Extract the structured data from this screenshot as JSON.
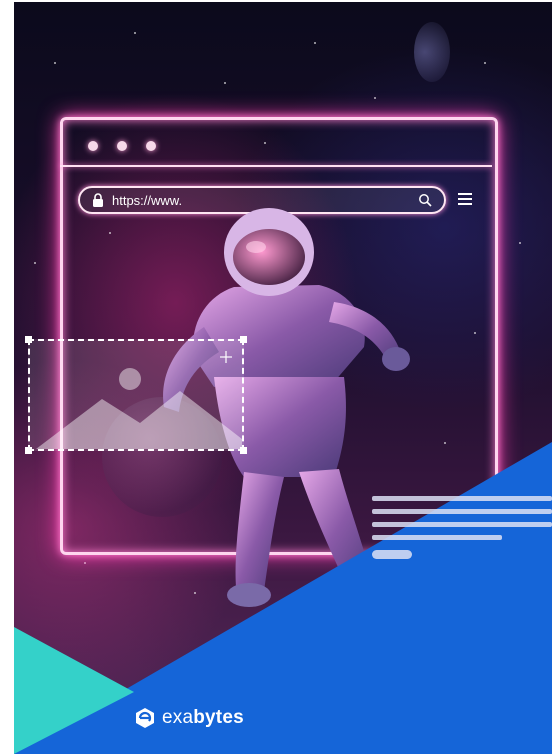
{
  "browser": {
    "url_text": "https://www.",
    "window_dots": 3
  },
  "brand": {
    "logo_regular": "exa",
    "logo_bold": "bytes"
  },
  "colors": {
    "neon": "#ffd6ef",
    "neon_glow": "#ff3fb0",
    "brand_blue": "#1565d8",
    "teal": "#34d1c9"
  },
  "icons": [
    "lock-icon",
    "search-icon",
    "menu-icon",
    "image-placeholder-icon",
    "exabytes-logo-icon"
  ]
}
